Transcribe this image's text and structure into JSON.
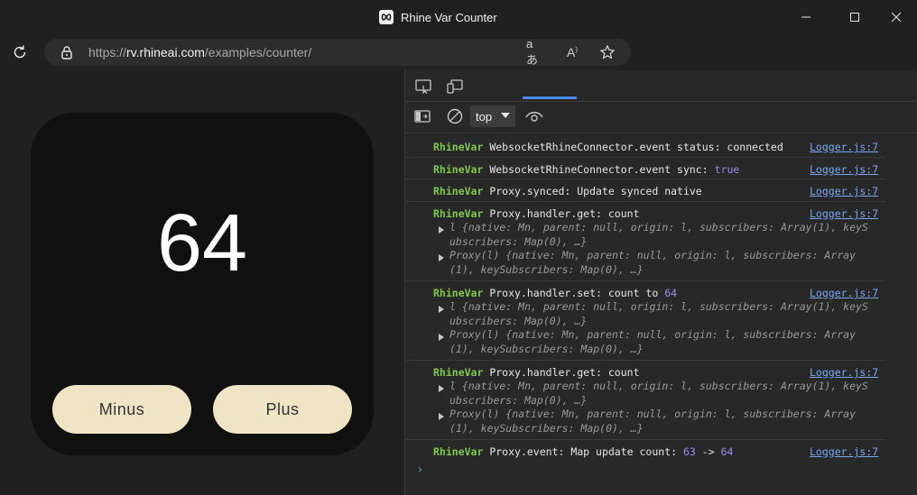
{
  "window": {
    "title": "Rhine Var Counter",
    "controls": [
      "minimize-icon",
      "maximize-icon",
      "close-icon"
    ]
  },
  "address_bar": {
    "protocol": "https://",
    "host": "rv.rhineai.com",
    "path": "/examples/counter/",
    "icons": [
      "read-aloud-icon",
      "immersive-reader-icon",
      "favorite-star-icon"
    ]
  },
  "counter": {
    "value": "64",
    "minus_label": "Minus",
    "plus_label": "Plus"
  },
  "devtools": {
    "context_selector": "top",
    "console": [
      {
        "tag": "RhineVar",
        "text": "WebsocketRhineConnector.event status: connected",
        "source": "Logger.js:7"
      },
      {
        "tag": "RhineVar",
        "text": "WebsocketRhineConnector.event sync:",
        "value": "true",
        "source": "Logger.js:7"
      },
      {
        "tag": "RhineVar",
        "text": "Proxy.synced: Update synced native",
        "source": "Logger.js:7"
      },
      {
        "tag": "RhineVar",
        "text": "Proxy.handler.get: count",
        "source": "Logger.js:7",
        "objects": [
          [
            "l {native: Mn, parent: null, origin: l, subscribers: Array(1), keyS",
            "ubscribers: Map(0), …}"
          ],
          [
            "Proxy(l) {native: Mn, parent: null, origin: l, subscribers: Array",
            "(1), keySubscribers: Map(0), …}"
          ]
        ]
      },
      {
        "tag": "RhineVar",
        "text": "Proxy.handler.set: count to",
        "value": "64",
        "source": "Logger.js:7",
        "objects": [
          [
            "l {native: Mn, parent: null, origin: l, subscribers: Array(1), keyS",
            "ubscribers: Map(0), …}"
          ],
          [
            "Proxy(l) {native: Mn, parent: null, origin: l, subscribers: Array",
            "(1), keySubscribers: Map(0), …}"
          ]
        ]
      },
      {
        "tag": "RhineVar",
        "text": "Proxy.handler.get: count",
        "source": "Logger.js:7",
        "objects": [
          [
            "l {native: Mn, parent: null, origin: l, subscribers: Array(1), keyS",
            "ubscribers: Map(0), …}"
          ],
          [
            "Proxy(l) {native: Mn, parent: null, origin: l, subscribers: Array",
            "(1), keySubscribers: Map(0), …}"
          ]
        ]
      },
      {
        "tag": "RhineVar",
        "text": "Proxy.event: Map update count:",
        "value": "63",
        "arrow": "->",
        "value2": "64",
        "source": "Logger.js:7"
      }
    ],
    "prompt": "›"
  }
}
